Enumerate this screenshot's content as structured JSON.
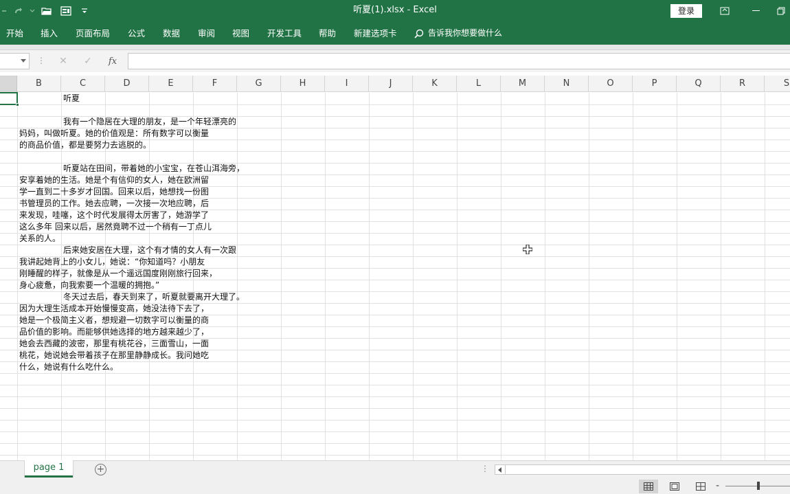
{
  "titlebar": {
    "doc_title": "听夏(1).xlsx  -  Excel",
    "login_label": "登录"
  },
  "ribbon": {
    "tabs": [
      "开始",
      "插入",
      "页面布局",
      "公式",
      "数据",
      "审阅",
      "视图",
      "开发工具",
      "帮助",
      "新建选项卡"
    ],
    "tell_me": "告诉我你想要做什么"
  },
  "formula_bar": {
    "fx_label": "fx",
    "value": ""
  },
  "grid": {
    "columns": [
      "B",
      "C",
      "D",
      "E",
      "F",
      "G",
      "H",
      "I",
      "J",
      "K",
      "L",
      "M",
      "N",
      "O",
      "P",
      "Q",
      "R",
      "S"
    ],
    "lines": [
      "听夏",
      "",
      "我有一个隐居在大理的朋友，是一个年轻漂亮的",
      "妈妈，叫做听夏。她的价值观是：所有数字可以衡量",
      "的商品价值，都是要努力去逃脱的。",
      "",
      "听夏站在田间，带着她的小宝宝，在苍山洱海旁，",
      "安享着她的生活。她是个有信仰的女人，她在欧洲留",
      "学一直到二十多岁才回国。回来以后，她想找一份图",
      "书管理员的工作。她去应聘，一次接一次地应聘，后",
      "来发现，哇噻，这个时代发展得太厉害了，她游学了",
      "这么多年  回来以后，居然竟聘不过一个稍有一丁点儿",
      "关系的人。",
      "后来她安居在大理，这个有才情的女人有一次跟",
      "我讲起她背上的小女儿，她说：“你知道吗？小朋友",
      "刚睡醒的样子，就像是从一个遥远国度刚刚旅行回来，",
      "身心疲惫，向我索要一个温暖的拥抱。”",
      "冬天过去后，春天到来了，听夏就要离开大理了。",
      "因为大理生活成本开始慢慢变高，她没法待下去了，",
      "她是一个极简主义者，想规避一切数字可以衡量的商",
      "品价值的影响。而能够供她选择的地方越来越少了，",
      "她会去西藏的波密，那里有桃花谷，三面雪山，一面",
      "桃花，她说她会带着孩子在那里静静成长。我问她吃",
      "什么，她说有什么吃什么。"
    ]
  },
  "sheets": {
    "active": "page 1",
    "add_label": "+"
  },
  "colors": {
    "accent": "#217346",
    "grid_line": "#e1e1e1"
  }
}
